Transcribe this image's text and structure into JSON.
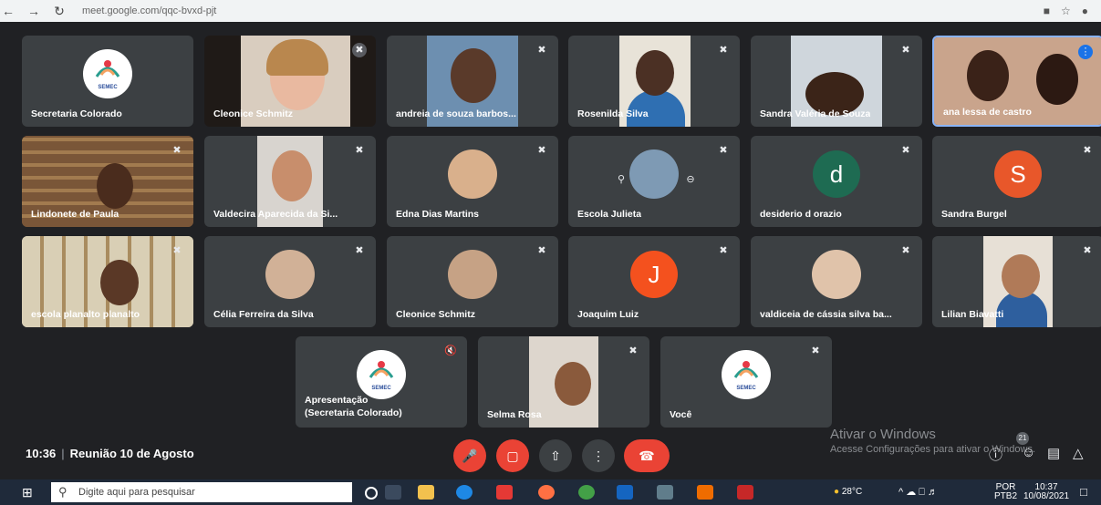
{
  "browser": {
    "url": "meet.google.com/qqc-bvxd-pjt",
    "back_icon": "arrow-left",
    "forward_icon": "arrow-right",
    "reload_icon": "reload"
  },
  "participants": [
    {
      "name": "Secretaria Colorado",
      "type": "logo"
    },
    {
      "name": "Cleonice Schmitz",
      "type": "video"
    },
    {
      "name": "andreia de souza barbos...",
      "type": "video"
    },
    {
      "name": "Rosenilda Silva",
      "type": "video"
    },
    {
      "name": "Sandra Valéria de Souza",
      "type": "video"
    },
    {
      "name": "ana lessa de castro",
      "type": "video"
    },
    {
      "name": "Lindonete de Paula",
      "type": "video"
    },
    {
      "name": "Valdecira Aparecida da Si...",
      "type": "video"
    },
    {
      "name": "Edna Dias Martins",
      "type": "photo"
    },
    {
      "name": "Escola Julieta",
      "type": "photo"
    },
    {
      "name": "desiderio d orazio",
      "type": "avatar",
      "initial": "d",
      "color": "#1e6b52"
    },
    {
      "name": "Sandra Burgel",
      "type": "avatar",
      "initial": "S",
      "color": "#e8572a"
    },
    {
      "name": "escola planalto planalto",
      "type": "video"
    },
    {
      "name": "Célia Ferreira da Silva",
      "type": "photo"
    },
    {
      "name": "Cleonice Schmitz",
      "type": "photo"
    },
    {
      "name": "Joaquim Luiz",
      "type": "avatar",
      "initial": "J",
      "color": "#f4511e"
    },
    {
      "name": "valdiceia de cássia silva ba...",
      "type": "photo"
    },
    {
      "name": "Lilian Biavatti",
      "type": "video"
    },
    {
      "name": "Apresentação\n(Secretaria Colorado)",
      "type": "logo"
    },
    {
      "name": "Selma Rosa",
      "type": "video"
    },
    {
      "name": "Você",
      "type": "logo"
    }
  ],
  "logo_text": "SEMEC",
  "meeting": {
    "time": "10:36",
    "separator": "|",
    "title": "Reunião 10 de Agosto",
    "participant_count": "21"
  },
  "controls": {
    "mic_icon": "mic-off",
    "camera_icon": "camera-off",
    "present_icon": "present-screen",
    "more_icon": "more-vertical",
    "hangup_icon": "phone-hangup"
  },
  "watermark": {
    "line1": "Ativar o Windows",
    "line2": "Acesse Configurações para ativar o Windows."
  },
  "taskbar": {
    "search_placeholder": "Digite aqui para pesquisar",
    "weather": "28°C",
    "language": "POR",
    "layout": "PTB2",
    "clock_time": "10:37",
    "clock_date": "10/08/2021"
  },
  "colors": {
    "background": "#202124",
    "tile": "#3c4043",
    "danger": "#ea4335"
  }
}
